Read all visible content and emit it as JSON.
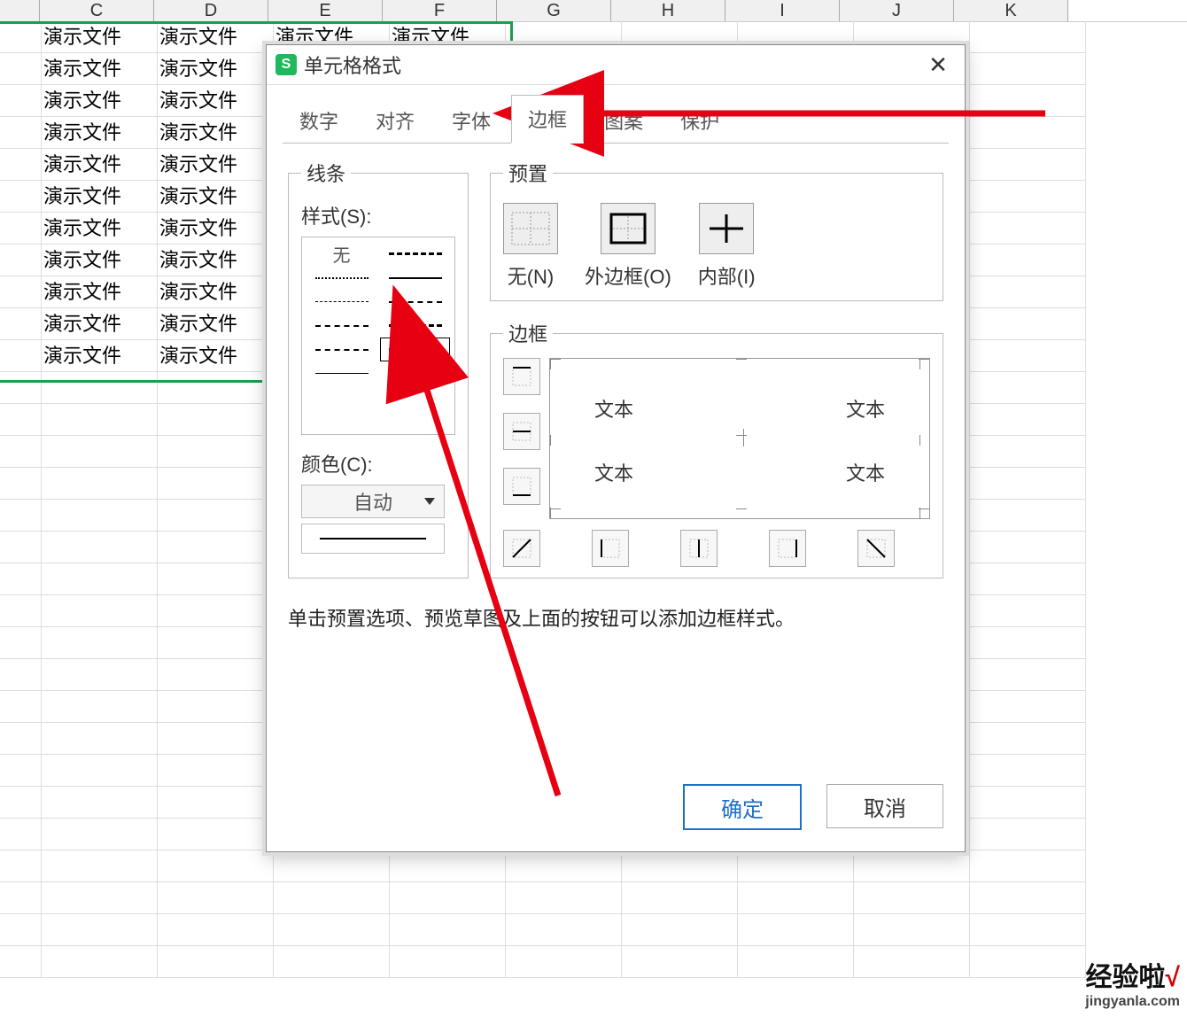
{
  "columns": [
    "C",
    "D",
    "E",
    "F",
    "G",
    "H",
    "I",
    "J",
    "K"
  ],
  "cell_text": "演示文件",
  "selection": {
    "cols": 5,
    "rows": 11
  },
  "dialog": {
    "title": "单元格格式",
    "tabs": [
      "数字",
      "对齐",
      "字体",
      "边框",
      "图案",
      "保护"
    ],
    "active_tab": 3,
    "line_group": "线条",
    "preset_group": "预置",
    "border_group": "边框",
    "style_label": "样式(S):",
    "style_none": "无",
    "color_label": "颜色(C):",
    "color_value": "自动",
    "presets": {
      "none": "无(N)",
      "outer": "外边框(O)",
      "inner": "内部(I)"
    },
    "preview_text": "文本",
    "hint": "单击预置选项、预览草图及上面的按钮可以添加边框样式。",
    "ok": "确定",
    "cancel": "取消"
  },
  "watermark": {
    "brand": "经验啦",
    "check": "√",
    "url": "jingyanla.com"
  }
}
